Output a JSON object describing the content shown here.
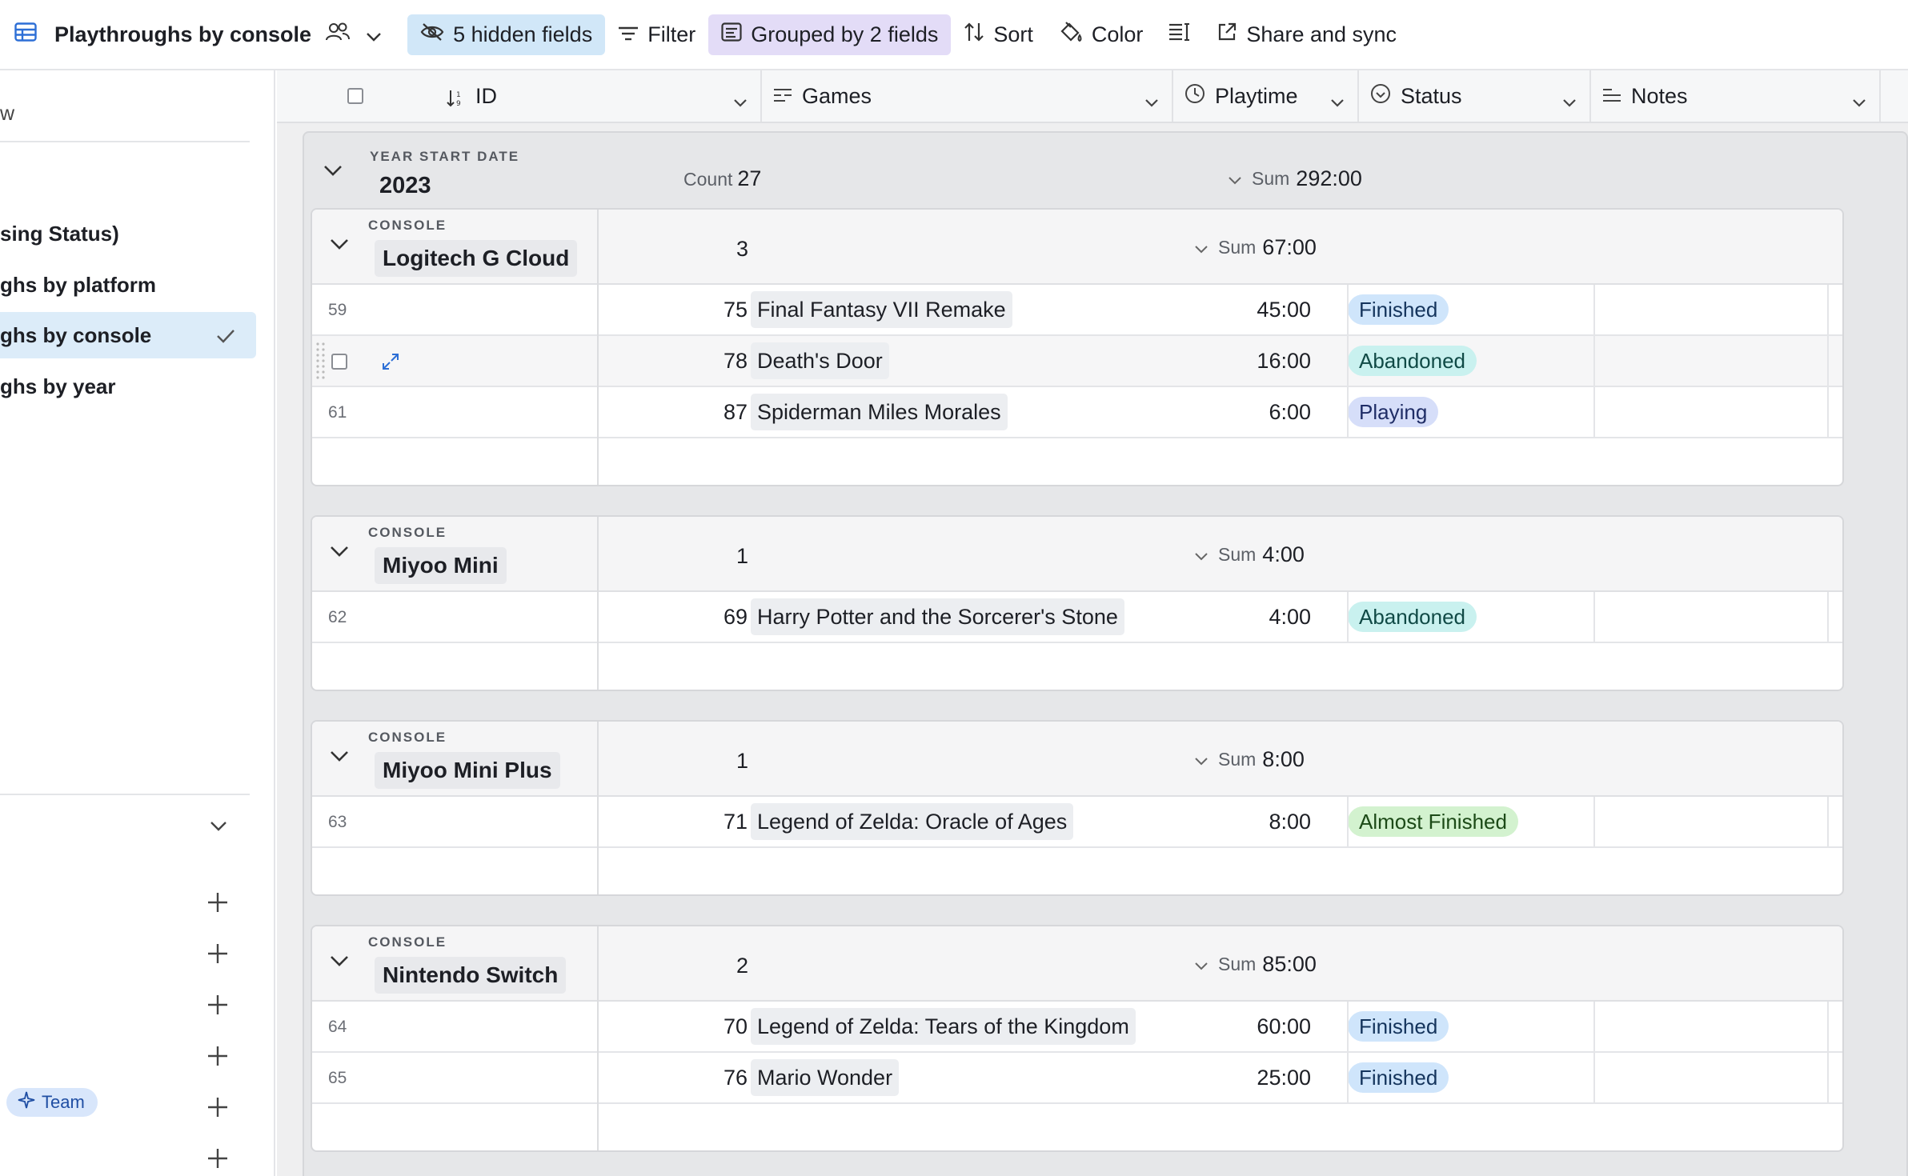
{
  "toolbar": {
    "view_name": "Playthroughs by console",
    "hidden_fields": "5 hidden fields",
    "filter": "Filter",
    "grouped": "Grouped by 2 fields",
    "sort": "Sort",
    "color": "Color",
    "share": "Share and sync"
  },
  "sidebar": {
    "search_fragment": "w",
    "views": [
      {
        "label": "sing Status)",
        "active": false
      },
      {
        "label": "ghs by platform",
        "active": false
      },
      {
        "label": "ghs by console",
        "active": true
      },
      {
        "label": "ghs by year",
        "active": false
      }
    ],
    "team_badge": "Team"
  },
  "columns": [
    {
      "name": "ID",
      "icon": "sort-number-icon"
    },
    {
      "name": "Games",
      "icon": "long-text-icon"
    },
    {
      "name": "Playtime",
      "icon": "clock-icon"
    },
    {
      "name": "Status",
      "icon": "status-icon"
    },
    {
      "name": "Notes",
      "icon": "notes-icon"
    }
  ],
  "year_group": {
    "label": "YEAR START DATE",
    "value": "2023",
    "count_label": "Count",
    "count": "27",
    "sum_label": "Sum",
    "sum": "292:00"
  },
  "status_colors": {
    "Finished": {
      "bg": "#cfe5fb",
      "fg": "#14345c"
    },
    "Abandoned": {
      "bg": "#c9f1ef",
      "fg": "#104a46"
    },
    "Playing": {
      "bg": "#d6def9",
      "fg": "#1f2d66"
    },
    "Almost Finished": {
      "bg": "#d3f2cf",
      "fg": "#1c4a17"
    }
  },
  "console_groups": [
    {
      "label": "CONSOLE",
      "name": "Logitech G Cloud",
      "count": "3",
      "sum_label": "Sum",
      "sum": "67:00",
      "rows": [
        {
          "row_num": "59",
          "id": "75",
          "game": "Final Fantasy VII Remake",
          "playtime": "45:00",
          "status": "Finished"
        },
        {
          "row_num": "",
          "id": "78",
          "game": "Death's Door",
          "playtime": "16:00",
          "status": "Abandoned",
          "hover": true
        },
        {
          "row_num": "61",
          "id": "87",
          "game": "Spiderman Miles Morales",
          "playtime": "6:00",
          "status": "Playing"
        }
      ]
    },
    {
      "label": "CONSOLE",
      "name": "Miyoo Mini",
      "count": "1",
      "sum_label": "Sum",
      "sum": "4:00",
      "rows": [
        {
          "row_num": "62",
          "id": "69",
          "game": "Harry Potter and the Sorcerer's Stone",
          "playtime": "4:00",
          "status": "Abandoned"
        }
      ]
    },
    {
      "label": "CONSOLE",
      "name": "Miyoo Mini Plus",
      "count": "1",
      "sum_label": "Sum",
      "sum": "8:00",
      "rows": [
        {
          "row_num": "63",
          "id": "71",
          "game": "Legend of Zelda: Oracle of Ages",
          "playtime": "8:00",
          "status": "Almost Finished"
        }
      ]
    },
    {
      "label": "CONSOLE",
      "name": "Nintendo Switch",
      "count": "2",
      "sum_label": "Sum",
      "sum": "85:00",
      "rows": [
        {
          "row_num": "64",
          "id": "70",
          "game": "Legend of Zelda: Tears of the Kingdom",
          "playtime": "60:00",
          "status": "Finished"
        },
        {
          "row_num": "65",
          "id": "76",
          "game": "Mario Wonder",
          "playtime": "25:00",
          "status": "Finished"
        }
      ]
    }
  ]
}
